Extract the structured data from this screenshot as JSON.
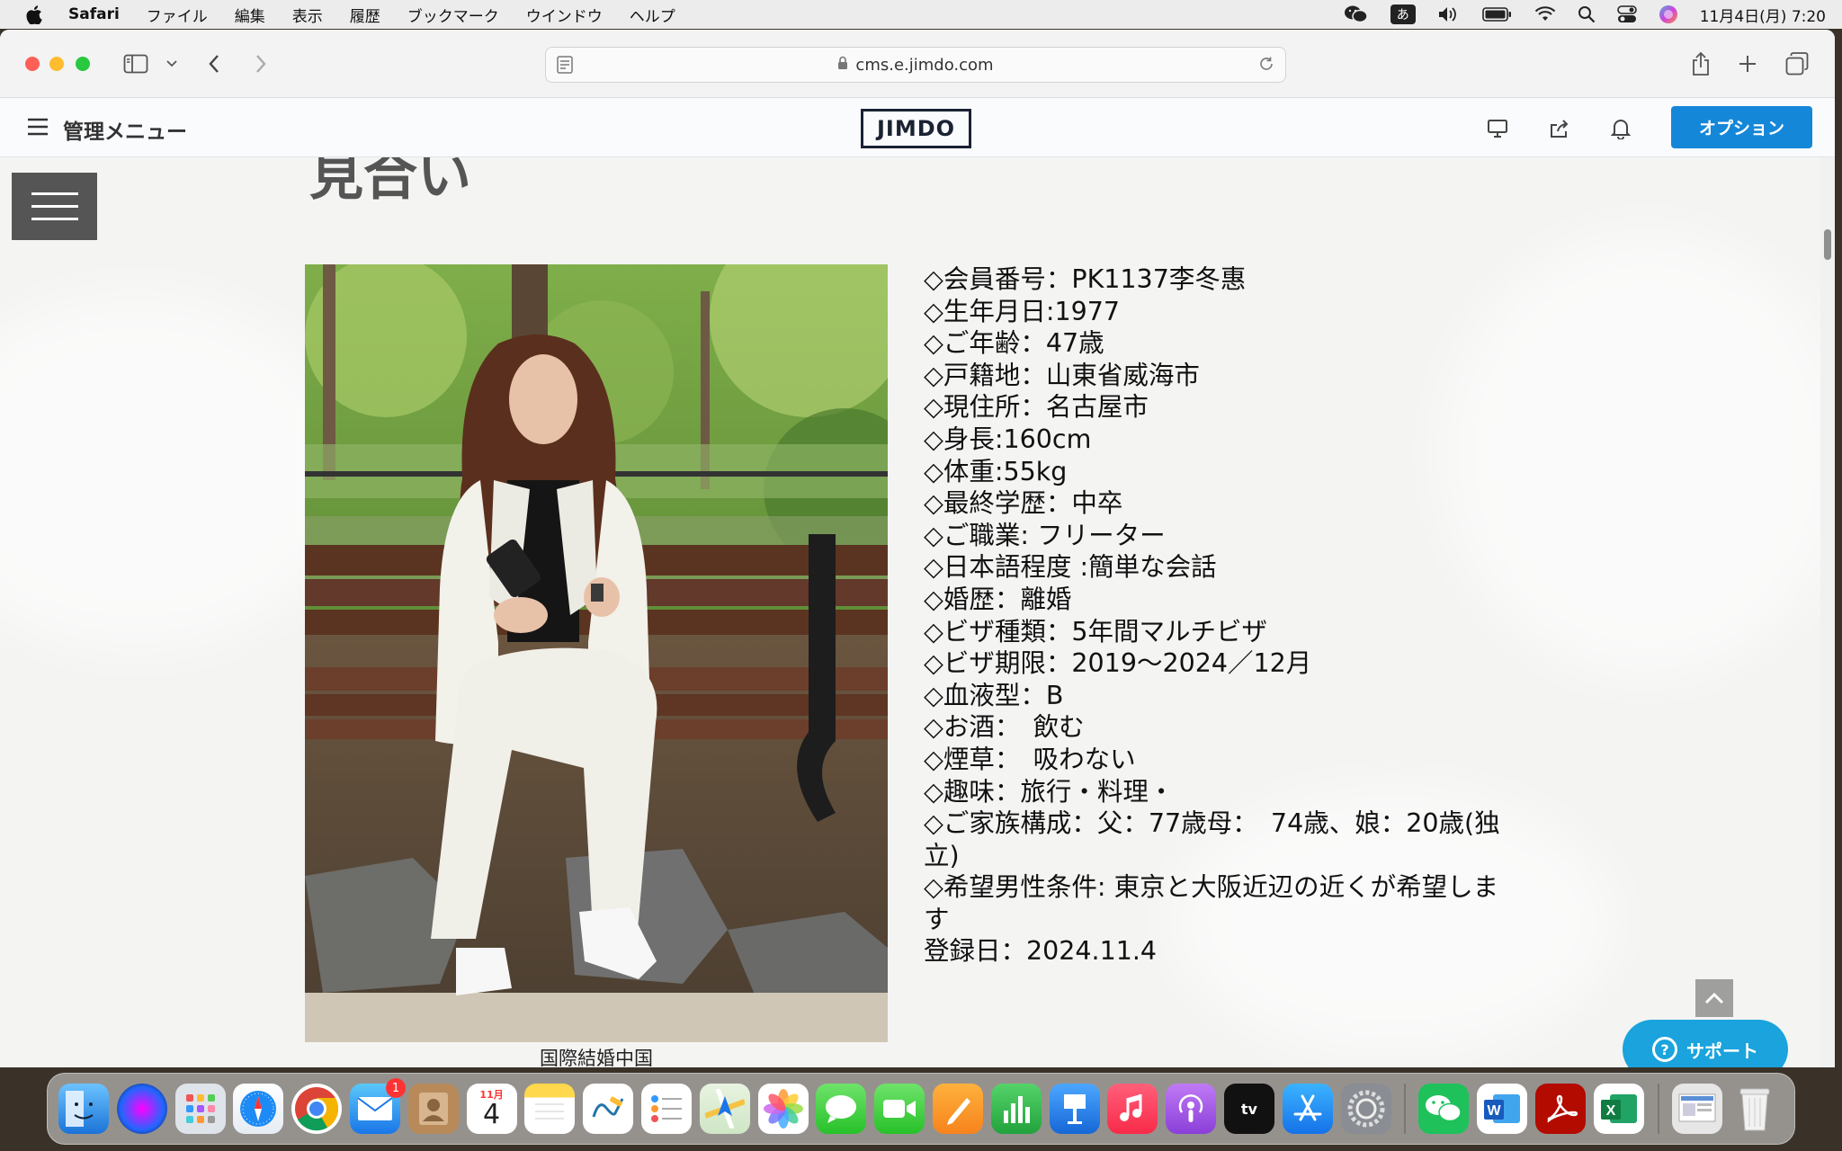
{
  "menubar": {
    "app_name": "Safari",
    "items": [
      "ファイル",
      "編集",
      "表示",
      "履歴",
      "ブックマーク",
      "ウインドウ",
      "ヘルプ"
    ],
    "ime_label": "あ",
    "clock": "11月4日(月) 7:20"
  },
  "browser": {
    "url": "cms.e.jimdo.com"
  },
  "admin": {
    "menu_label": "管理メニュー",
    "logo": "JIMDO",
    "option_label": "オプション"
  },
  "page": {
    "title": "見合い",
    "photo_caption": "国際結婚中国",
    "profile_lines": [
      "◇会員番号：PK1137李冬惠",
      "◇生年月日:1977",
      "◇ご年齢：47歳",
      "◇戸籍地：山東省威海市",
      "◇現住所：名古屋市",
      "◇身長:160cm",
      "◇体重:55kg",
      "◇最終学歴：中卒",
      "◇ご職業: フリーター",
      "◇日本語程度 :簡単な会話",
      "◇婚歴：離婚",
      "◇ビザ種類：5年間マルチビザ",
      "◇ビザ期限：2019～2024／12月",
      "◇血液型：B",
      "◇お酒：　飲む",
      "◇煙草：　吸わない",
      "◇趣味：旅行・料理・",
      "◇ご家族構成：父：77歳母：　74歳、娘：20歳(独立)",
      "◇希望男性条件:  東京と大阪近辺の近くが希望します",
      "登録日：2024.11.4"
    ],
    "support_label": "サポート"
  },
  "dock": {
    "mail_badge": "1",
    "calendar_month": "11月",
    "calendar_day": "4",
    "tv_label": "tv"
  }
}
